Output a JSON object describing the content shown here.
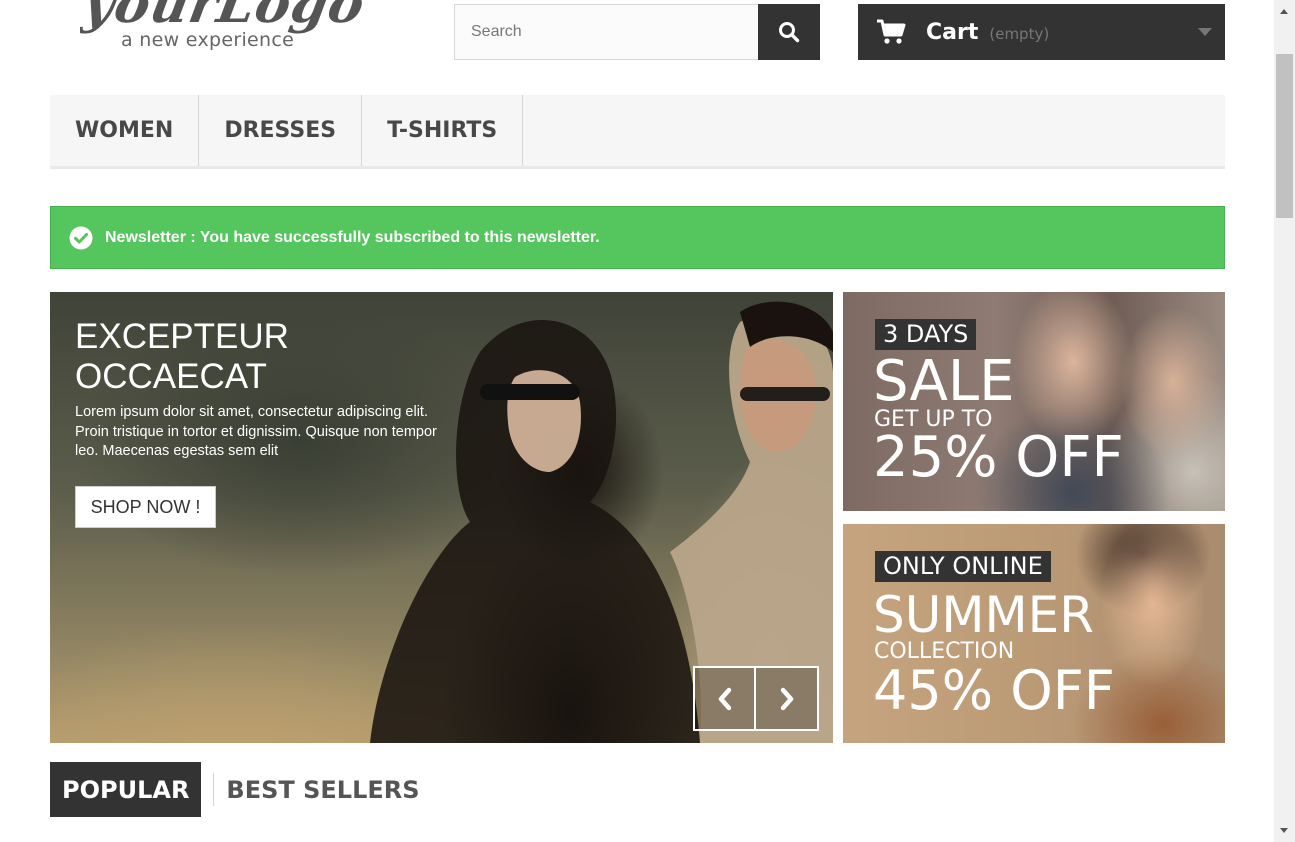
{
  "logo": {
    "script_text": "yourLogo",
    "tagline": "a new experience"
  },
  "search": {
    "placeholder": "Search",
    "button_icon": "search-icon"
  },
  "cart": {
    "icon": "shopping-cart-icon",
    "label": "Cart",
    "status": "(empty)"
  },
  "menu": {
    "items": [
      {
        "label": "WOMEN"
      },
      {
        "label": "DRESSES"
      },
      {
        "label": "T-SHIRTS"
      }
    ]
  },
  "alert": {
    "icon": "check-circle-icon",
    "message": "Newsletter : You have successfully subscribed to this newsletter."
  },
  "slider": {
    "title_line1": "EXCEPTEUR",
    "title_line2": "OCCAECAT",
    "description": "Lorem ipsum dolor sit amet, consectetur adipiscing elit. Proin tristique in tortor et dignissim. Quisque non tempor leo. Maecenas egestas sem elit",
    "button_label": "SHOP NOW !",
    "prev_icon": "chevron-left-icon",
    "next_icon": "chevron-right-icon"
  },
  "banners": [
    {
      "tag": "3 DAYS",
      "headline": "SALE",
      "subline": "GET UP TO",
      "offer": "25% OFF"
    },
    {
      "tag": "ONLY ONLINE",
      "headline": "SUMMER",
      "subline": "COLLECTION",
      "offer": "45% OFF"
    }
  ],
  "tabs": [
    {
      "label": "POPULAR",
      "active": true
    },
    {
      "label": "BEST SELLERS",
      "active": false
    }
  ],
  "colors": {
    "dark": "#333333",
    "success": "#55c65e",
    "menu_bg": "#f6f6f6"
  }
}
